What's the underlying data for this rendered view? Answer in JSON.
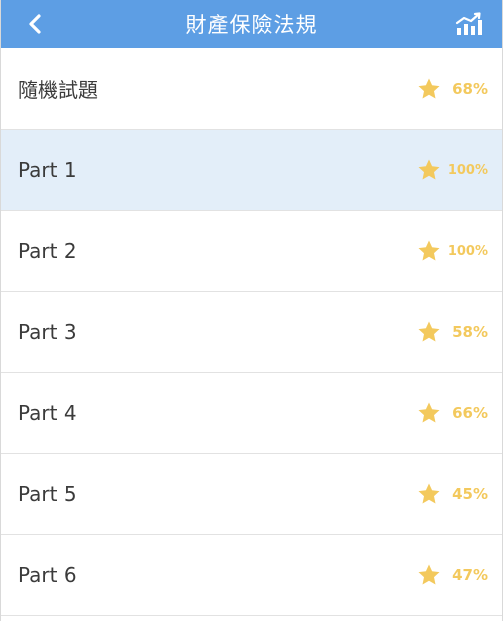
{
  "header": {
    "title": "財產保險法規",
    "back_icon": "chevron-left-icon",
    "stats_icon": "bar-chart-trend-icon",
    "background_color": "#5d9ee4"
  },
  "accent_color": "#f3c95d",
  "selected_row_color": "#e3eef9",
  "rows": [
    {
      "label": "隨機試題",
      "score": "68%",
      "icon": "star-icon",
      "selected": false
    },
    {
      "label": "Part 1",
      "score": "100%",
      "icon": "star-icon",
      "selected": true
    },
    {
      "label": "Part 2",
      "score": "100%",
      "icon": "star-icon",
      "selected": false
    },
    {
      "label": "Part 3",
      "score": "58%",
      "icon": "star-icon",
      "selected": false
    },
    {
      "label": "Part 4",
      "score": "66%",
      "icon": "star-icon",
      "selected": false
    },
    {
      "label": "Part 5",
      "score": "45%",
      "icon": "star-icon",
      "selected": false
    },
    {
      "label": "Part 6",
      "score": "47%",
      "icon": "star-icon",
      "selected": false
    }
  ]
}
